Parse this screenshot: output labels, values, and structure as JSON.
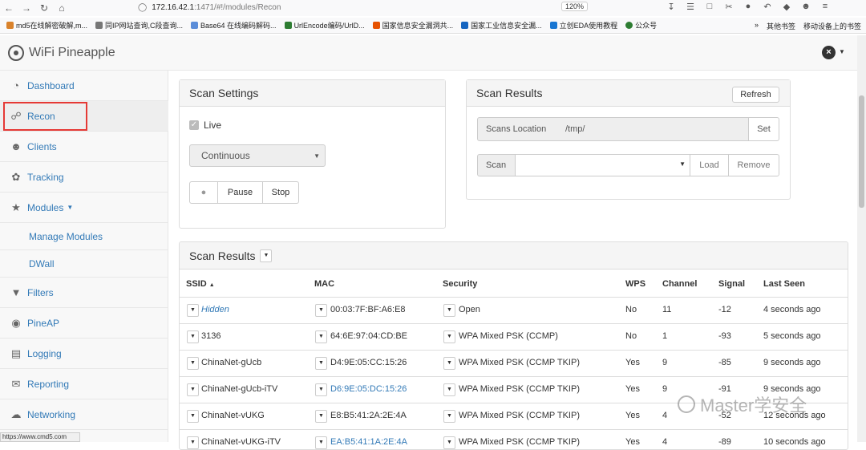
{
  "browser": {
    "url_host": "172.16.42.1",
    "url_path": ":1471/#!/modules/Recon",
    "zoom": "120%",
    "bookmarks": [
      "md5在线解密破解,m...",
      "同IP网站查询,C段查询...",
      "Base64 在线编码解码...",
      "UrlEncode编码/UrlD...",
      "国家信息安全漏洞共...",
      "国家工业信息安全漏...",
      "立创EDA使用教程",
      "公众号"
    ],
    "bookmarks_right": [
      "其他书签",
      "移动设备上的书签"
    ],
    "status_url": "https://www.cmd5.com"
  },
  "app": {
    "brand": "WiFi Pineapple"
  },
  "sidebar": {
    "items": [
      {
        "label": "Dashboard",
        "icon": "gauge-icon"
      },
      {
        "label": "Recon",
        "icon": "binoculars-icon"
      },
      {
        "label": "Clients",
        "icon": "users-icon"
      },
      {
        "label": "Tracking",
        "icon": "footprints-icon"
      },
      {
        "label": "Modules",
        "icon": "star-icon"
      },
      {
        "label": "Manage Modules"
      },
      {
        "label": "DWall"
      },
      {
        "label": "Filters",
        "icon": "filter-icon"
      },
      {
        "label": "PineAP",
        "icon": "antenna-icon"
      },
      {
        "label": "Logging",
        "icon": "log-icon"
      },
      {
        "label": "Reporting",
        "icon": "envelope-icon"
      },
      {
        "label": "Networking",
        "icon": "network-icon"
      }
    ]
  },
  "scan_settings": {
    "title": "Scan Settings",
    "live_label": "Live",
    "mode": "Continuous",
    "pause_label": "Pause",
    "stop_label": "Stop"
  },
  "scan_results_panel": {
    "title": "Scan Results",
    "refresh_label": "Refresh",
    "location_label": "Scans Location",
    "location_value": "/tmp/",
    "set_label": "Set",
    "scan_label": "Scan",
    "load_label": "Load",
    "remove_label": "Remove"
  },
  "results_table": {
    "title": "Scan Results",
    "headers": {
      "ssid": "SSID",
      "mac": "MAC",
      "security": "Security",
      "wps": "WPS",
      "channel": "Channel",
      "signal": "Signal",
      "last_seen": "Last Seen"
    },
    "rows": [
      {
        "ssid": "Hidden",
        "mac": "00:03:7F:BF:A6:E8",
        "security": "Open",
        "wps": "No",
        "channel": "11",
        "signal": "-12",
        "last_seen": "4 seconds ago"
      },
      {
        "ssid": "3136",
        "mac": "64:6E:97:04:CD:BE",
        "security": "WPA Mixed PSK (CCMP)",
        "wps": "No",
        "channel": "1",
        "signal": "-93",
        "last_seen": "5 seconds ago"
      },
      {
        "ssid": "ChinaNet-gUcb",
        "mac": "D4:9E:05:CC:15:26",
        "security": "WPA Mixed PSK (CCMP TKIP)",
        "wps": "Yes",
        "channel": "9",
        "signal": "-85",
        "last_seen": "9 seconds ago"
      },
      {
        "ssid": "ChinaNet-gUcb-iTV",
        "mac": "D6:9E:05:DC:15:26",
        "security": "WPA Mixed PSK (CCMP TKIP)",
        "wps": "Yes",
        "channel": "9",
        "signal": "-91",
        "last_seen": "9 seconds ago"
      },
      {
        "ssid": "ChinaNet-vUKG",
        "mac": "E8:B5:41:2A:2E:4A",
        "security": "WPA Mixed PSK (CCMP TKIP)",
        "wps": "Yes",
        "channel": "4",
        "signal": "-52",
        "last_seen": "12 seconds ago"
      },
      {
        "ssid": "ChinaNet-vUKG-iTV",
        "mac": "EA:B5:41:1A:2E:4A",
        "security": "WPA Mixed PSK (CCMP TKIP)",
        "wps": "Yes",
        "channel": "4",
        "signal": "-89",
        "last_seen": "10 seconds ago"
      }
    ]
  },
  "watermark": "Master学安全"
}
